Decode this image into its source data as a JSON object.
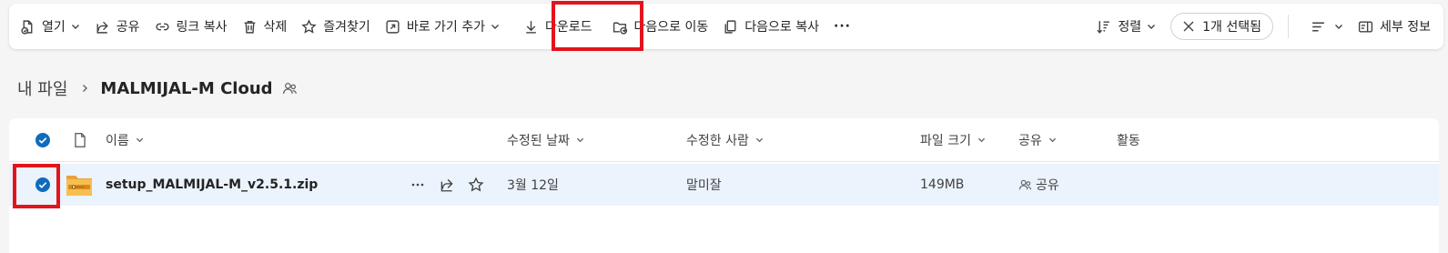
{
  "toolbar": {
    "open": "열기",
    "share": "공유",
    "copy_link": "링크 복사",
    "delete": "삭제",
    "favorite": "즐겨찾기",
    "add_shortcut": "바로 가기 추가",
    "download": "다운로드",
    "move_to": "다음으로 이동",
    "copy_to": "다음으로 복사",
    "more": "···",
    "sort": "정렬",
    "selected": "1개 선택됨",
    "details": "세부 정보"
  },
  "breadcrumb": {
    "root": "내 파일",
    "current": "MALMIJAL-M Cloud"
  },
  "table": {
    "columns": {
      "name": "이름",
      "modified": "수정된 날짜",
      "modified_by": "수정한 사람",
      "size": "파일 크기",
      "sharing": "공유",
      "activity": "활동"
    },
    "rows": [
      {
        "name": "setup_MALMIJAL-M_v2.5.1.zip",
        "modified": "3월 12일",
        "modified_by": "말미잘",
        "size": "149MB",
        "sharing": "공유",
        "selected": true
      }
    ]
  },
  "colors": {
    "accent": "#0f6cbd",
    "highlight": "#e3141c",
    "selected_row": "#ebf3fc"
  }
}
